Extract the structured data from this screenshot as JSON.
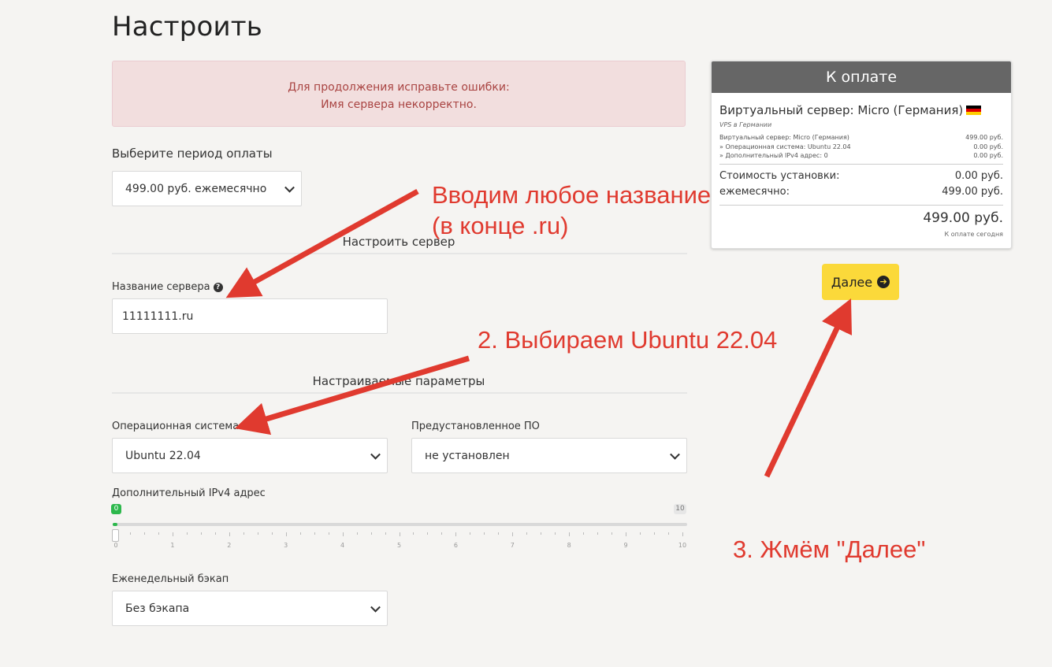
{
  "page": {
    "title": "Настроить"
  },
  "alert": {
    "line1": "Для продолжения исправьте ошибки:",
    "line2": "Имя сервера некорректно."
  },
  "billing": {
    "label": "Выберите период оплаты",
    "selected": "499.00 руб. ежемесячно"
  },
  "configure_server": {
    "title": "Настроить сервер",
    "server_name_label": "Название сервера",
    "server_name_value": "11111111.ru"
  },
  "custom_options": {
    "title": "Настраиваемые параметры",
    "os_label": "Операционная система",
    "os_selected": "Ubuntu 22.04",
    "software_label": "Предустановленное ПО",
    "software_selected": "не установлен",
    "ipv4_label": "Дополнительный IPv4 адрес",
    "ipv4_value": "0",
    "ipv4_max": "10",
    "ipv4_ticks": [
      "0",
      "1",
      "2",
      "3",
      "4",
      "5",
      "6",
      "7",
      "8",
      "9",
      "10"
    ],
    "backup_label": "Еженедельный бэкап",
    "backup_selected": "Без бэкапа"
  },
  "summary": {
    "header": "К оплате",
    "product_name": "Виртуальный сервер: Micro (Германия)",
    "product_sub": "VPS в Германии",
    "lines": [
      {
        "label": "Виртуальный сервер: Micro (Германия)",
        "price": "499.00 руб."
      },
      {
        "label": "» Операционная система: Ubuntu 22.04",
        "price": "0.00 руб."
      },
      {
        "label": "» Дополнительный IPv4 адрес: 0",
        "price": "0.00 руб."
      }
    ],
    "setup_label": "Стоимость установки:",
    "setup_price": "0.00 руб.",
    "monthly_label": "ежемесячно:",
    "monthly_price": "499.00 руб.",
    "total": "499.00 руб.",
    "total_note": "К оплате сегодня",
    "flag_colors": [
      "#000000",
      "#dd0000",
      "#ffce00"
    ]
  },
  "next_button": {
    "label": "Далее"
  },
  "annotations": {
    "step1_line1": "Вводим любое название",
    "step1_line2": "(в конце .ru)",
    "step2": "2. Выбираем Ubuntu 22.04",
    "step3": "3. Жмём \"Далее\"",
    "color": "#e03a2f"
  }
}
